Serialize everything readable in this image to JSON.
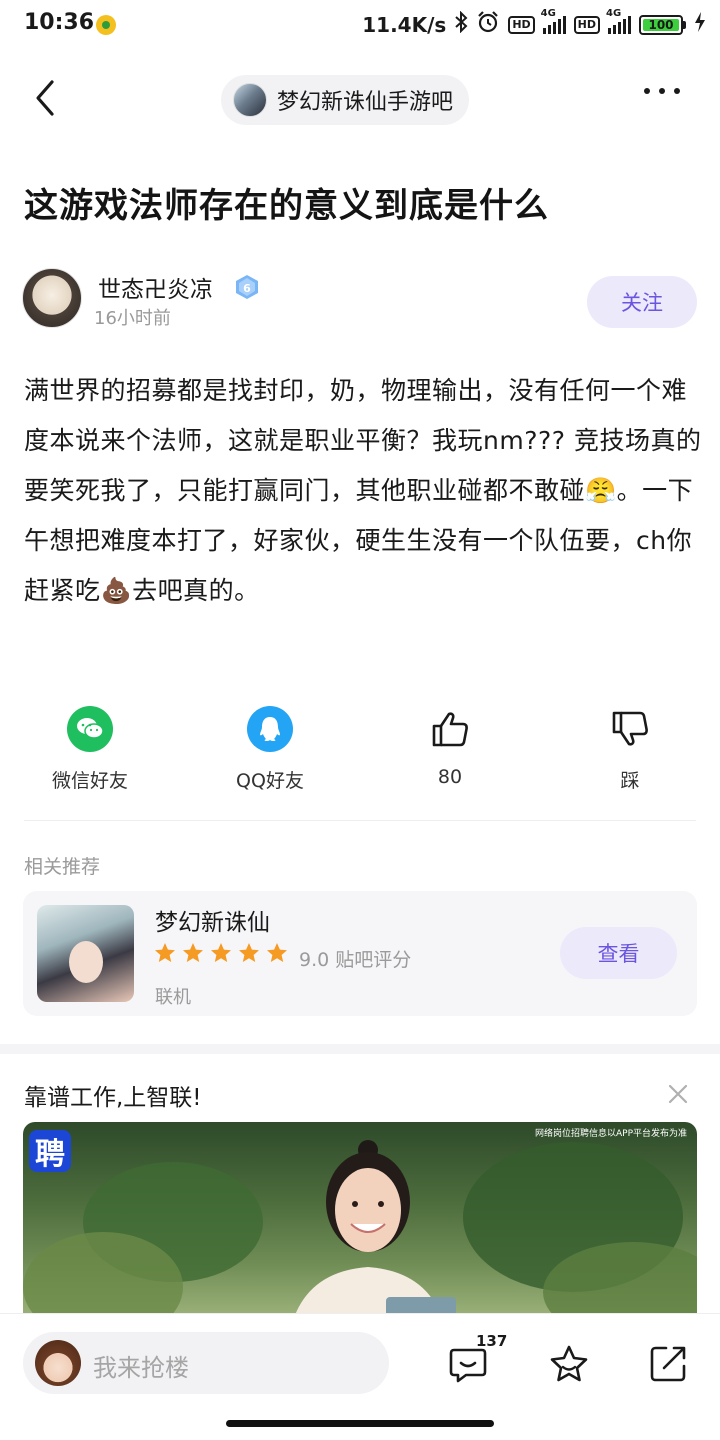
{
  "status_bar": {
    "time": "10:36",
    "net_speed": "11.4K/s",
    "hd1": "HD",
    "hd2": "HD",
    "net_type1": "4G",
    "net_type2": "4G",
    "battery": "100",
    "icons": [
      "bluetooth-icon",
      "alarm-icon",
      "signal-icon",
      "battery-icon",
      "charging-icon"
    ]
  },
  "nav": {
    "forum_name": "梦幻新诛仙手游吧",
    "back_icon": "chevron-left-icon",
    "more_icon": "more-dots-icon"
  },
  "post": {
    "title": "这游戏法师存在的意义到底是什么",
    "author": {
      "name": "世态卍炎凉",
      "level": "6",
      "time": "16小时前",
      "follow_label": "关注"
    },
    "body_parts": {
      "p1": "满世界的招募都是找封印，奶，物理输出，没有任何一个难度本说来个法师，这就是职业平衡？我玩nm??? 竞技场真的要笑死我了，只能打赢同门，其他职业碰都不敢碰",
      "emoji1": "😤",
      "p2": "。一下午想把难度本打了，好家伙，硬生生没有一个队伍要，ch你赶紧吃",
      "emoji2": "💩",
      "p3": "去吧真的。"
    }
  },
  "share": {
    "wechat_label": "微信好友",
    "qq_label": "QQ好友",
    "like_count": "80",
    "dislike_label": "踩"
  },
  "related": {
    "heading": "相关推荐",
    "game_name": "梦幻新诛仙",
    "rating_stars": 5,
    "score_text": "9.0 贴吧评分",
    "tag": "联机",
    "view_label": "查看"
  },
  "ad": {
    "title": "靠谱工作,上智联!",
    "logo_text": "聘",
    "disclaimer": "网络岗位招聘信息以APP平台发布为准"
  },
  "bottom_bar": {
    "placeholder": "我来抢楼",
    "comment_count": "137"
  },
  "colors": {
    "accent": "#6a55e0",
    "accent_bg": "#ece9fb",
    "wechat_green": "#1fbe5f",
    "qq_blue": "#24a4f4",
    "star": "#f59a23"
  }
}
